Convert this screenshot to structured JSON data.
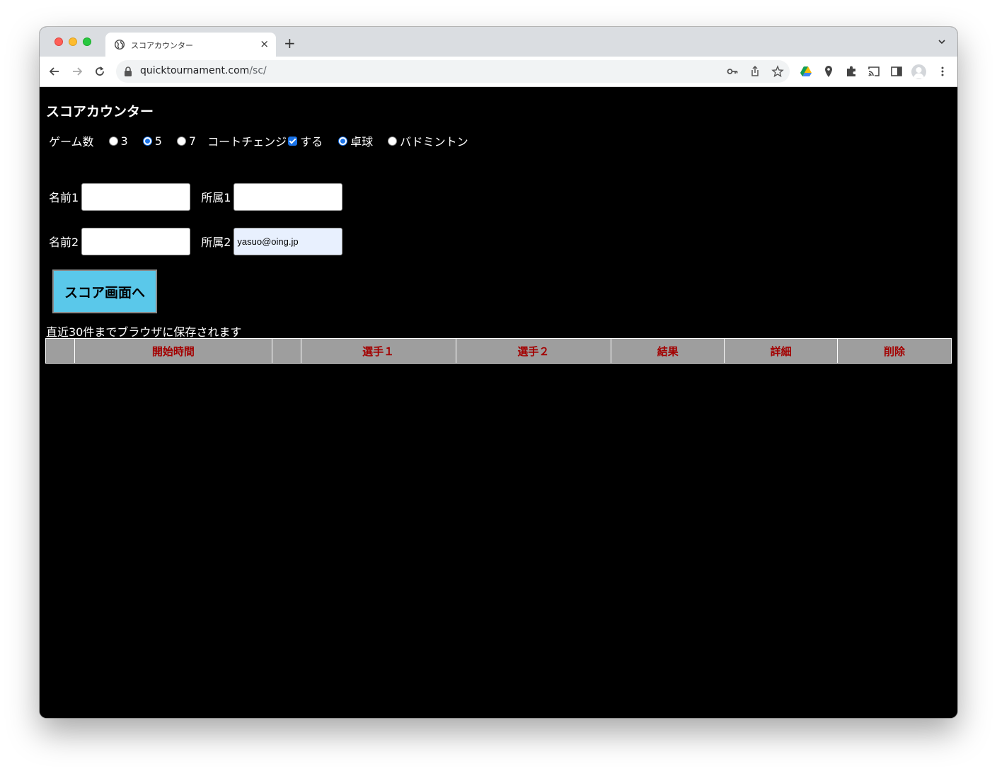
{
  "browser": {
    "tab_title": "スコアカウンター",
    "new_tab_label": "+",
    "close_label": "×",
    "url_host": "quicktournament.com",
    "url_path": "/sc/"
  },
  "page": {
    "title": "スコアカウンター",
    "games": {
      "label": "ゲーム数",
      "options": [
        "3",
        "5",
        "7"
      ],
      "selected": "5"
    },
    "court_change": {
      "label": "コートチェンジ",
      "checkbox_label": "する",
      "checked": true
    },
    "sport": {
      "options": [
        "卓球",
        "バドミントン"
      ],
      "selected": "卓球"
    },
    "player1": {
      "name_label": "名前1",
      "name_value": "",
      "team_label": "所属1",
      "team_value": ""
    },
    "player2": {
      "name_label": "名前2",
      "name_value": "",
      "team_label": "所属2",
      "team_value": "yasuo@oing.jp"
    },
    "submit_label": "スコア画面へ",
    "save_note": "直近30件までブラウザに保存されます",
    "table": {
      "headers": [
        "",
        "開始時間",
        "",
        "選手１",
        "選手２",
        "結果",
        "詳細",
        "削除"
      ]
    }
  },
  "colors": {
    "page_bg": "#000000",
    "button_bg": "#5ac8ea",
    "table_bg": "#9e9e9e",
    "table_header_text": "#a30000"
  }
}
